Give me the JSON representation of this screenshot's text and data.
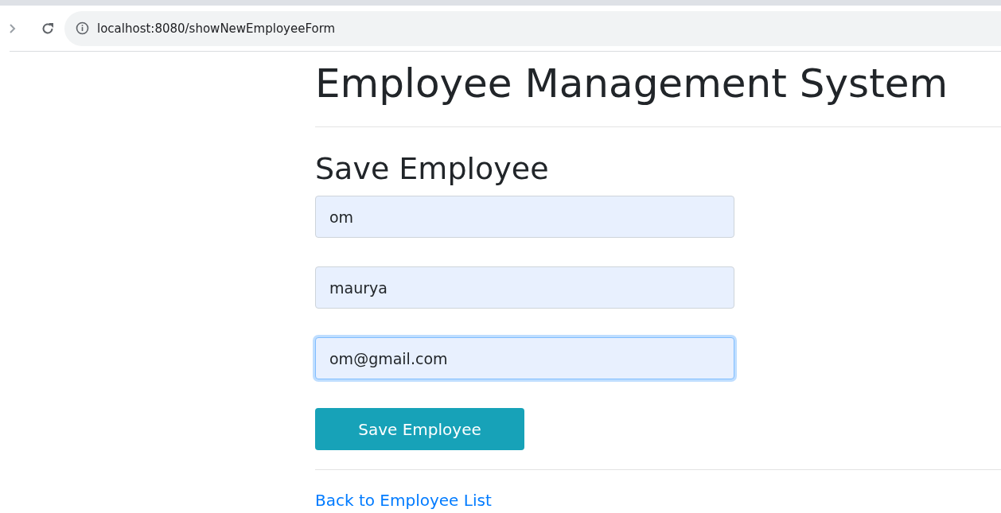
{
  "browser": {
    "url": "localhost:8080/showNewEmployeeForm"
  },
  "heading": "Employee Management System",
  "subheading": "Save Employee",
  "fields": [
    {
      "value": "om",
      "focused": false
    },
    {
      "value": "maurya",
      "focused": false
    },
    {
      "value": "om@gmail.com",
      "focused": true
    }
  ],
  "button": "Save Employee",
  "link": "Back to Employee List"
}
